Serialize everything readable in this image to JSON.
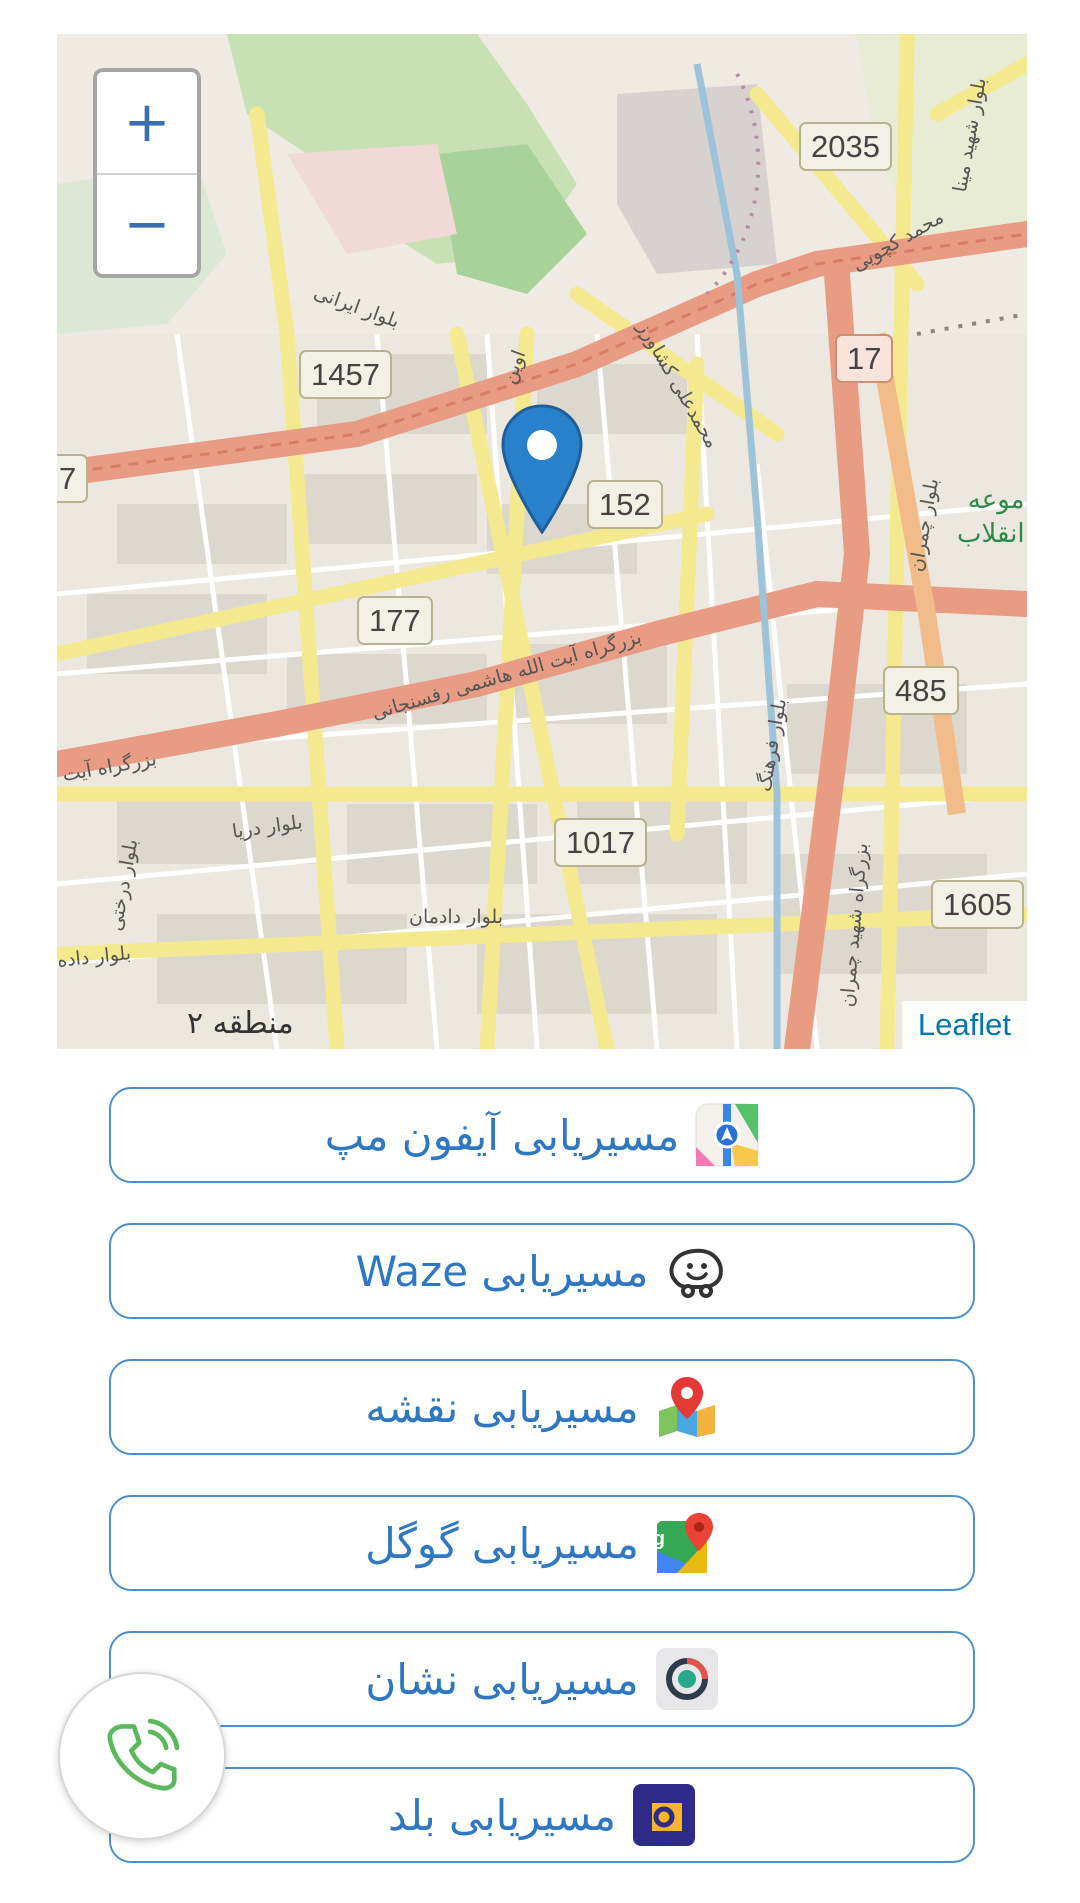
{
  "map": {
    "attribution": "Leaflet",
    "zoom_in": "+",
    "zoom_out": "−",
    "shields": [
      "2035",
      "17",
      "1457",
      "152",
      "177",
      "485",
      "1017",
      "1605",
      "7"
    ],
    "streets": [
      "بلوار شهید مینا",
      "محمد کچویی",
      "بلوار ایرانی",
      "اوین",
      "محمدعلی کشاورز",
      "بلوار چمران",
      "بزرگراه شهید چمران",
      "بزرگراه آیت الله هاشمی رفسنجانی",
      "بلوار دریا",
      "بلوار دادمان",
      "بلوار فرهنگ",
      "بزرگراه آیت",
      "بلوار درختی",
      "بلوار داده"
    ],
    "region": "منطقه ۲",
    "park": [
      "موعه",
      "انقلاب"
    ]
  },
  "buttons": [
    {
      "label": "مسیریابی آیفون مپ",
      "icon": "apple-maps-icon"
    },
    {
      "label": "مسیریابی Waze",
      "icon": "waze-icon"
    },
    {
      "label": "مسیریابی نقشه",
      "icon": "neshan-map-icon"
    },
    {
      "label": "مسیریابی گوگل",
      "icon": "google-maps-icon"
    },
    {
      "label": "مسیریابی نشان",
      "icon": "neshan-icon"
    },
    {
      "label": "مسیریابی بلد",
      "icon": "balad-icon"
    }
  ],
  "call": {
    "icon": "phone-icon"
  },
  "colors": {
    "accent": "#2f78c1",
    "border": "#4f8fc9",
    "call": "#5cb85c"
  }
}
